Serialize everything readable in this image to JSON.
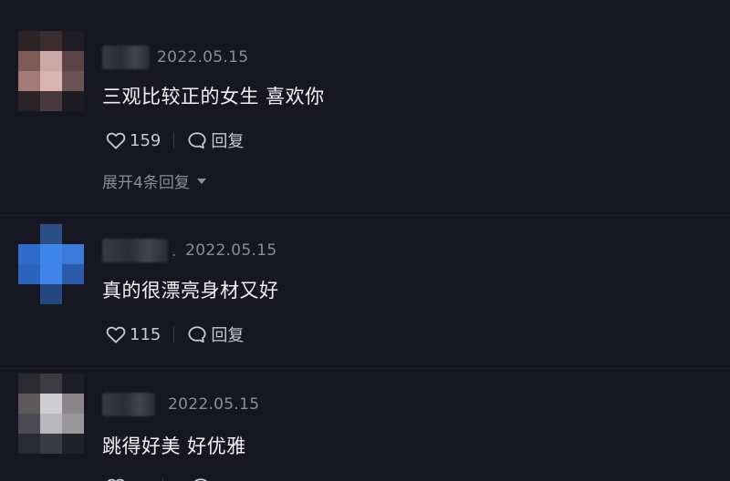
{
  "comments": [
    {
      "date": "2022.05.15",
      "text": "三观比较正的女生 喜欢你",
      "likes": "159",
      "reply_label": "回复",
      "expand_label": "展开4条回复"
    },
    {
      "date": "2022.05.15",
      "text": "真的很漂亮身材又好",
      "likes": "115",
      "reply_label": "回复"
    },
    {
      "date": "2022.05.15",
      "text": "跳得好美 好优雅"
    }
  ],
  "icons": {
    "like": "heart-outline-icon",
    "reply": "speech-bubble-icon",
    "expand": "caret-down-icon"
  },
  "colors": {
    "background": "#161722",
    "primary_text": "#f2f2f4",
    "secondary_text": "#8b8c96",
    "avatar_blue": "#3f86e8"
  }
}
